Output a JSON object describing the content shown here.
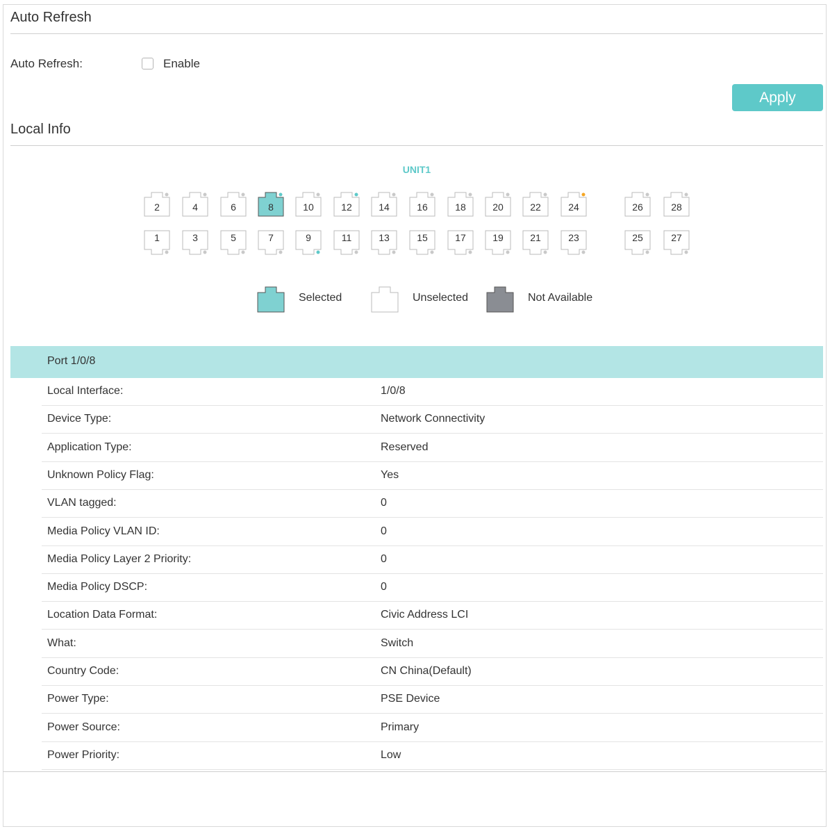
{
  "auto_refresh": {
    "section_title": "Auto Refresh",
    "field_label": "Auto Refresh:",
    "checkbox_label": "Enable",
    "checked": false,
    "apply_label": "Apply"
  },
  "local_info": {
    "section_title": "Local Info",
    "unit_label": "UNIT1",
    "top_ports": [
      "2",
      "4",
      "6",
      "8",
      "10",
      "12",
      "14",
      "16",
      "18",
      "20",
      "22",
      "24",
      "26",
      "28"
    ],
    "bottom_ports": [
      "1",
      "3",
      "5",
      "7",
      "9",
      "11",
      "13",
      "15",
      "17",
      "19",
      "21",
      "23",
      "25",
      "27"
    ],
    "selected_port": "8",
    "port_indicators": {
      "8": "teal",
      "12": "teal",
      "9": "teal",
      "24": "orange"
    },
    "legend": {
      "selected": "Selected",
      "unselected": "Unselected",
      "not_available": "Not Available"
    },
    "port_header": "Port 1/0/8",
    "rows": [
      {
        "label": "Local Interface:",
        "value": "1/0/8"
      },
      {
        "label": "Device Type:",
        "value": "Network Connectivity"
      },
      {
        "label": "Application Type:",
        "value": "Reserved"
      },
      {
        "label": "Unknown Policy Flag:",
        "value": "Yes"
      },
      {
        "label": "VLAN tagged:",
        "value": "0"
      },
      {
        "label": "Media Policy VLAN ID:",
        "value": "0"
      },
      {
        "label": "Media Policy Layer 2 Priority:",
        "value": "0"
      },
      {
        "label": "Media Policy DSCP:",
        "value": "0"
      },
      {
        "label": "Location Data Format:",
        "value": "Civic Address LCI"
      },
      {
        "label": "What:",
        "value": "Switch"
      },
      {
        "label": "Country Code:",
        "value": "CN China(Default)"
      },
      {
        "label": "Power Type:",
        "value": "PSE Device"
      },
      {
        "label": "Power Source:",
        "value": "Primary"
      },
      {
        "label": "Power Priority:",
        "value": "Low"
      }
    ]
  },
  "colors": {
    "accent": "#5ec9c9",
    "selected_fill": "#7fd1d1",
    "not_available_fill": "#8a8d93",
    "header_bg": "#b3e5e5",
    "indicator_orange": "#f5a623",
    "indicator_default": "#c9c9c9"
  }
}
